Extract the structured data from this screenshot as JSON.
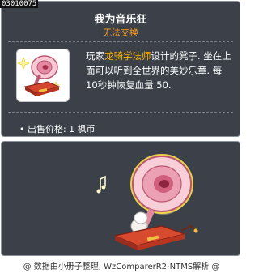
{
  "item_id": "03010075",
  "title": "我为音乐狂",
  "subtitle": "无法交换",
  "description": {
    "prefix": "玩家",
    "highlight": "龙骑学法师",
    "suffix": "设计的凳子. 坐在上面可以听到全世界的美妙乐章. 每10秒钟恢复血量 50."
  },
  "sale_price": "• 出售价格: 1 枫币",
  "footer": "@ 数据由小册子整理, WzComparerR2-NTMS解析 @",
  "icons": {
    "item_icon": "gramophone-chair-icon",
    "preview_image": "gramophone-chair-preview",
    "note_icon": "music-note-icon"
  },
  "colors": {
    "panel_bg": "#3b4049",
    "title": "#ffffff",
    "subtitle": "#ff9d1c",
    "highlight": "#ffb400"
  }
}
